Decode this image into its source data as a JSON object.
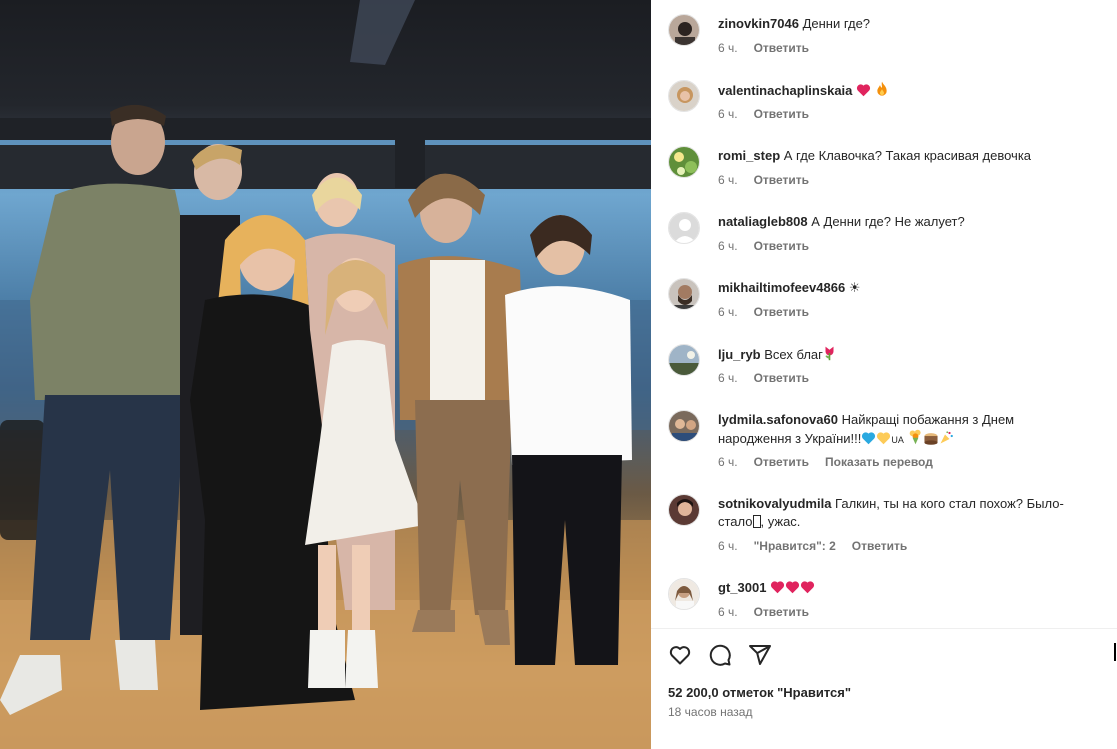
{
  "post_image": {
    "description_icon": "photo"
  },
  "comments": [
    {
      "username": "zinovkin7046",
      "text": "Денни где?",
      "time": "6 ч.",
      "reply": "Ответить",
      "likes": "",
      "translate": ""
    },
    {
      "username": "valentinachaplinskaia",
      "text": "",
      "emojis": [
        "heart-icon",
        "fire-icon"
      ],
      "time": "6 ч.",
      "reply": "Ответить",
      "likes": "",
      "translate": ""
    },
    {
      "username": "romi_step",
      "text": "А где Клавочка? Такая красивая девочка",
      "time": "6 ч.",
      "reply": "Ответить",
      "likes": "",
      "translate": ""
    },
    {
      "username": "nataliagleb808",
      "text": "А Денни где? Не жалует?",
      "time": "6 ч.",
      "reply": "Ответить",
      "likes": "",
      "translate": ""
    },
    {
      "username": "mikhailtimofeev4866",
      "text": "☀",
      "time": "6 ч.",
      "reply": "Ответить",
      "likes": "",
      "translate": ""
    },
    {
      "username": "lju_ryb",
      "text": "Всех благ",
      "emojis": [
        "tulip-icon"
      ],
      "time": "6 ч.",
      "reply": "Ответить",
      "likes": "",
      "translate": ""
    },
    {
      "username": "lydmila.safonova60",
      "text": "Найкращі побажання з Днем народження з України!!!",
      "text_tail": "UA",
      "emojis": [
        "blue-heart-icon",
        "yellow-heart-icon"
      ],
      "emojis_tail": [
        "bouquet-icon",
        "cake-icon",
        "party-popper-icon"
      ],
      "time": "6 ч.",
      "reply": "Ответить",
      "likes": "",
      "translate": "Показать перевод"
    },
    {
      "username": "sotnikovalyudmila",
      "text": "Галкин, ты на кого стал похож? Было-стало",
      "text_tail": ", ужас.",
      "time": "6 ч.",
      "reply": "Ответить",
      "likes": "\"Нравится\": 2",
      "translate": ""
    },
    {
      "username": "gt_3001",
      "text": "",
      "emojis": [
        "heart-icon",
        "heart-icon",
        "heart-icon"
      ],
      "time": "6 ч.",
      "reply": "Ответить",
      "likes": "",
      "translate": ""
    }
  ],
  "actions": {
    "like_icon": "heart-outline-icon",
    "comment_icon": "comment-icon",
    "share_icon": "share-icon",
    "likes_count": "52 200,0 отметок \"Нравится\"",
    "posted_ago": "18 часов назад"
  },
  "colors": {
    "heart": "#ed4956",
    "meta_text": "#737373",
    "username": "#262626"
  }
}
